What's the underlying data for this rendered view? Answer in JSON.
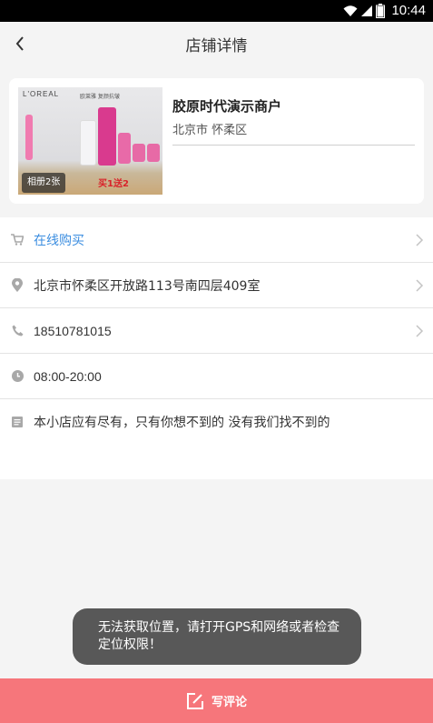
{
  "status_bar": {
    "time": "10:44"
  },
  "nav": {
    "title": "店铺详情"
  },
  "store": {
    "name": "胶原时代演示商户",
    "district": "北京市 怀柔区",
    "album_label": "相册2张",
    "image_brand": "L'OREAL",
    "image_tagline": "欧莱雅 复颜抗皱",
    "image_promo": "买1送2"
  },
  "info": {
    "buy_online": "在线购买",
    "address": "北京市怀柔区开放路113号南四层409室",
    "phone": "18510781015",
    "hours": "08:00-20:00",
    "description": "本小店应有尽有，只有你想不到的 没有我们找不到的"
  },
  "toast": {
    "message": "无法获取位置，请打开GPS和网络或者检查定位权限！"
  },
  "footer": {
    "comment_label": "写评论"
  },
  "colors": {
    "accent_link": "#3c8ee0",
    "footer_bg": "#f6767b",
    "toast_bg": "#4b4b4b"
  }
}
